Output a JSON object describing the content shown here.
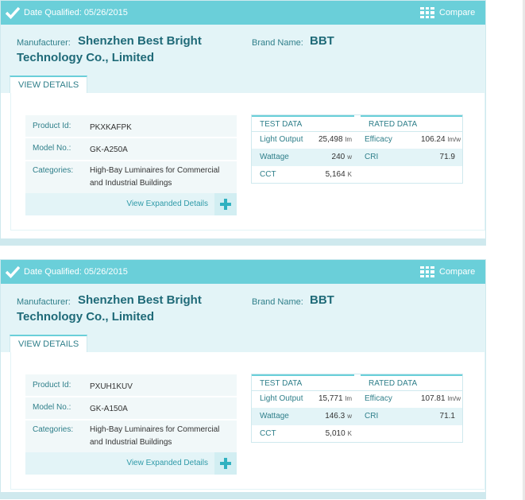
{
  "colors": {
    "accent": "#6acfd9",
    "label": "#2f7f8a",
    "link": "#2f9aa8",
    "light_bg": "#e3f4f7"
  },
  "cards": [
    {
      "date_qualified": "Date Qualified: 05/26/2015",
      "compare_label": "Compare",
      "manufacturer_label": "Manufacturer:",
      "manufacturer": "Shenzhen Best Bright Technology Co., Limited",
      "brand_label": "Brand Name:",
      "brand": "BBT",
      "tab_label": "VIEW DETAILS",
      "product_id_label": "Product Id:",
      "product_id": "PKXKAFPK",
      "model_label": "Model No.:",
      "model": "GK-A250A",
      "categories_label": "Categories:",
      "categories": "High-Bay Luminaires for Commercial and Industrial Buildings",
      "expand_label": "View Expanded Details",
      "test_data_label": "TEST DATA",
      "rated_data_label": "RATED DATA",
      "light_output_label": "Light Output",
      "light_output": "25,498",
      "light_output_unit": "lm",
      "wattage_label": "Wattage",
      "wattage": "240",
      "wattage_unit": "w",
      "cct_label": "CCT",
      "cct": "5,164",
      "cct_unit": "K",
      "efficacy_label": "Efficacy",
      "efficacy": "106.24",
      "efficacy_unit": "lm/w",
      "cri_label": "CRI",
      "cri": "71.9"
    },
    {
      "date_qualified": "Date Qualified: 05/26/2015",
      "compare_label": "Compare",
      "manufacturer_label": "Manufacturer:",
      "manufacturer": "Shenzhen Best Bright Technology Co., Limited",
      "brand_label": "Brand Name:",
      "brand": "BBT",
      "tab_label": "VIEW DETAILS",
      "product_id_label": "Product Id:",
      "product_id": "PXUH1KUV",
      "model_label": "Model No.:",
      "model": "GK-A150A",
      "categories_label": "Categories:",
      "categories": "High-Bay Luminaires for Commercial and Industrial Buildings",
      "expand_label": "View Expanded Details",
      "test_data_label": "TEST DATA",
      "rated_data_label": "RATED DATA",
      "light_output_label": "Light Output",
      "light_output": "15,771",
      "light_output_unit": "lm",
      "wattage_label": "Wattage",
      "wattage": "146.3",
      "wattage_unit": "w",
      "cct_label": "CCT",
      "cct": "5,010",
      "cct_unit": "K",
      "efficacy_label": "Efficacy",
      "efficacy": "107.81",
      "efficacy_unit": "lm/w",
      "cri_label": "CRI",
      "cri": "71.1"
    }
  ]
}
